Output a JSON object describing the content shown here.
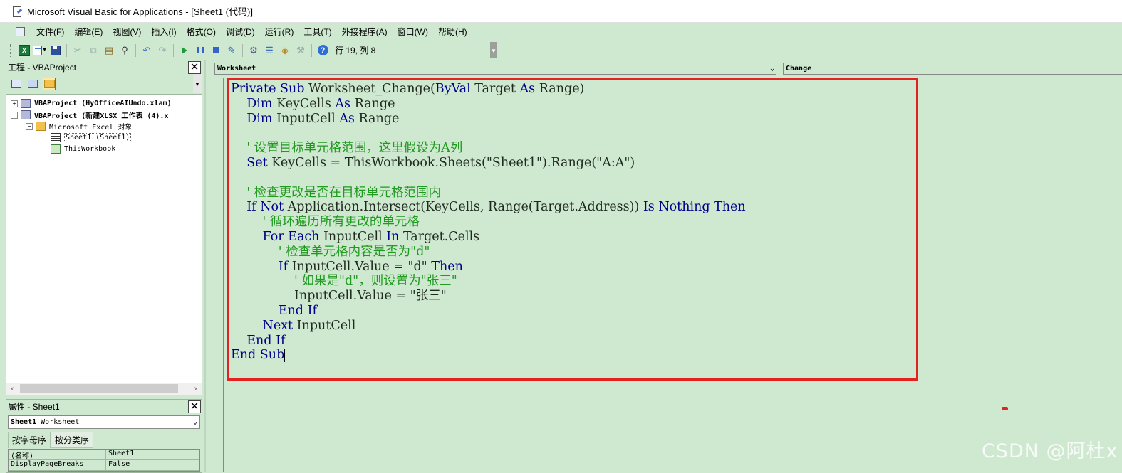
{
  "window": {
    "title": "Microsoft Visual Basic for Applications - [Sheet1 (代码)]"
  },
  "menu": [
    "文件(F)",
    "编辑(E)",
    "视图(V)",
    "插入(I)",
    "格式(O)",
    "调试(D)",
    "运行(R)",
    "工具(T)",
    "外接程序(A)",
    "窗口(W)",
    "帮助(H)"
  ],
  "toolbar": {
    "position": "行 19, 列 8",
    "icons": [
      "excel-icon",
      "insert-userform-icon",
      "save-icon",
      "cut-icon",
      "copy-icon",
      "paste-icon",
      "find-icon",
      "undo-icon",
      "redo-icon",
      "run-icon",
      "break-icon",
      "reset-icon",
      "design-mode-icon",
      "project-explorer-icon",
      "properties-icon",
      "object-browser-icon",
      "toolbox-icon",
      "help-icon"
    ]
  },
  "project_panel": {
    "title": "工程 - VBAProject",
    "tree": {
      "project1": "VBAProject (HyOfficeAIUndo.xlam)",
      "project2": "VBAProject (新建XLSX 工作表 (4).x",
      "folder": "Microsoft Excel 对象",
      "sheet1": "Sheet1 (Sheet1)",
      "workbook": "ThisWorkbook"
    }
  },
  "properties_panel": {
    "title": "属性 - Sheet1",
    "object_name": "Sheet1",
    "object_type": "Worksheet",
    "tabs": [
      "按字母序",
      "按分类序"
    ],
    "rows": [
      {
        "key": "(名称)",
        "value": "Sheet1"
      },
      {
        "key": "DisplayPageBreaks",
        "value": "False"
      }
    ]
  },
  "code_window": {
    "object_combo": "Worksheet",
    "procedure_combo": "Change",
    "lines": [
      [
        [
          "kw",
          "Private Sub "
        ],
        [
          "tx",
          "Worksheet_Change("
        ],
        [
          "kw",
          "ByVal "
        ],
        [
          "tx",
          "Target "
        ],
        [
          "kw",
          "As "
        ],
        [
          "tx",
          "Range)"
        ]
      ],
      [
        [
          "tx",
          "    "
        ],
        [
          "kw",
          "Dim "
        ],
        [
          "tx",
          "KeyCells "
        ],
        [
          "kw",
          "As "
        ],
        [
          "tx",
          "Range"
        ]
      ],
      [
        [
          "tx",
          "    "
        ],
        [
          "kw",
          "Dim "
        ],
        [
          "tx",
          "InputCell "
        ],
        [
          "kw",
          "As "
        ],
        [
          "tx",
          "Range"
        ]
      ],
      [
        [
          "tx",
          ""
        ]
      ],
      [
        [
          "tx",
          "    "
        ],
        [
          "cm",
          "' 设置目标单元格范围，这里假设为A列"
        ]
      ],
      [
        [
          "tx",
          "    "
        ],
        [
          "kw",
          "Set "
        ],
        [
          "tx",
          "KeyCells = ThisWorkbook.Sheets(\"Sheet1\").Range(\"A:A\")"
        ]
      ],
      [
        [
          "tx",
          ""
        ]
      ],
      [
        [
          "tx",
          "    "
        ],
        [
          "cm",
          "' 检查更改是否在目标单元格范围内"
        ]
      ],
      [
        [
          "tx",
          "    "
        ],
        [
          "kw",
          "If Not "
        ],
        [
          "tx",
          "Application.Intersect(KeyCells, Range(Target.Address)) "
        ],
        [
          "kw",
          "Is Nothing Then"
        ]
      ],
      [
        [
          "tx",
          "        "
        ],
        [
          "cm",
          "' 循环遍历所有更改的单元格"
        ]
      ],
      [
        [
          "tx",
          "        "
        ],
        [
          "kw",
          "For Each "
        ],
        [
          "tx",
          "InputCell "
        ],
        [
          "kw",
          "In "
        ],
        [
          "tx",
          "Target.Cells"
        ]
      ],
      [
        [
          "tx",
          "            "
        ],
        [
          "cm",
          "' 检查单元格内容是否为\"d\""
        ]
      ],
      [
        [
          "tx",
          "            "
        ],
        [
          "kw",
          "If "
        ],
        [
          "tx",
          "InputCell.Value = \"d\" "
        ],
        [
          "kw",
          "Then"
        ]
      ],
      [
        [
          "tx",
          "                "
        ],
        [
          "cm",
          "' 如果是\"d\"，则设置为\"张三\""
        ]
      ],
      [
        [
          "tx",
          "                "
        ],
        [
          "tx",
          "InputCell.Value = \"张三\""
        ]
      ],
      [
        [
          "tx",
          "            "
        ],
        [
          "kw",
          "End If"
        ]
      ],
      [
        [
          "tx",
          "        "
        ],
        [
          "kw",
          "Next "
        ],
        [
          "tx",
          "InputCell"
        ]
      ],
      [
        [
          "tx",
          "    "
        ],
        [
          "kw",
          "End If"
        ]
      ],
      [
        [
          "kw",
          "End Sub"
        ]
      ]
    ]
  },
  "watermark": "CSDN @阿杜x",
  "colors": {
    "keyword": "#00008b",
    "comment": "#1e9a1e",
    "background": "#cfe8d0",
    "highlight": "#e52222"
  }
}
